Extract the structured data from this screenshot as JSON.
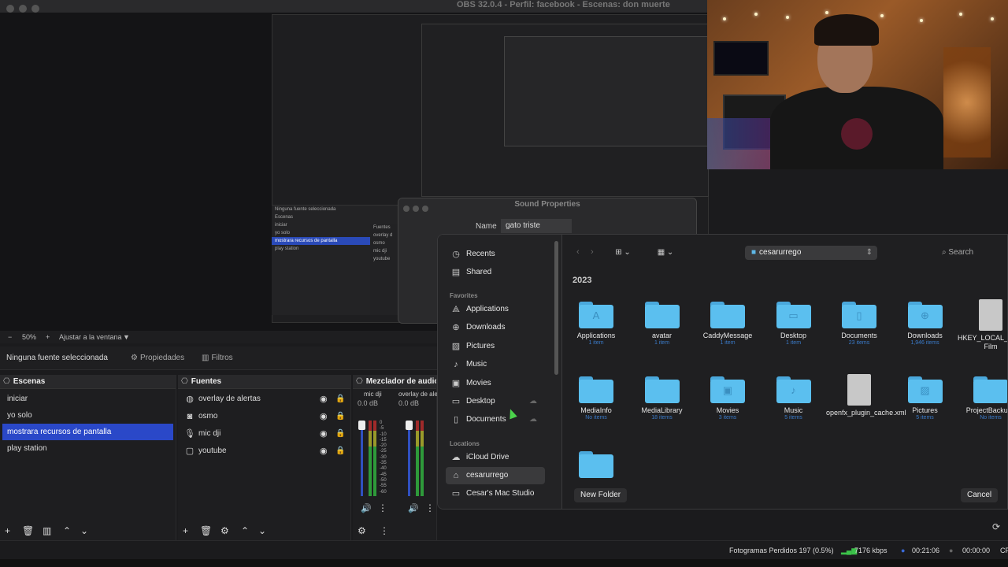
{
  "window": {
    "title": "OBS 32.0.4 - Perfil: facebook - Escenas: don muerte"
  },
  "preview": {
    "mini_scenes": [
      "Escenas",
      "iniciar",
      "yo solo",
      "mostrara recursos de pantalla",
      "play station"
    ],
    "mini_sources": [
      "Fuentes",
      "overlay d",
      "osmo",
      "mic dji",
      "youtube"
    ],
    "mini_nosel": "Ninguna fuente seleccionada",
    "mini_props": "Propiedades"
  },
  "sound_properties": {
    "title": "Sound Properties",
    "name_label": "Name",
    "name_value": "gato triste"
  },
  "zoombar": {
    "minus": "−",
    "zoom": "50%",
    "plus": "+",
    "fit": "Ajustar a la ventana",
    "caret": "▼"
  },
  "source_bar": {
    "no_selection": "Ninguna fuente seleccionada",
    "properties": "Propiedades",
    "filters": "Filtros"
  },
  "scenes": {
    "title": "Escenas",
    "items": [
      "iniciar",
      "yo solo",
      "mostrara recursos de pantalla",
      "play station"
    ],
    "selected_index": 2
  },
  "sources": {
    "title": "Fuentes",
    "items": [
      {
        "label": "overlay de alertas",
        "icon": "globe-icon"
      },
      {
        "label": "osmo",
        "icon": "camera-icon"
      },
      {
        "label": "mic dji",
        "icon": "microphone-icon"
      },
      {
        "label": "youtube",
        "icon": "window-icon"
      }
    ]
  },
  "mixer": {
    "title": "Mezclador de audio",
    "channels": [
      {
        "name": "mic dji",
        "db": "0.0 dB"
      },
      {
        "name": "overlay de ale",
        "db": "0.0 dB"
      }
    ],
    "ticks": [
      "0",
      "-5",
      "-10",
      "-15",
      "-20",
      "-25",
      "-30",
      "-35",
      "-40",
      "-45",
      "-50",
      "-55",
      "-60"
    ]
  },
  "file_dialog": {
    "sidebar": {
      "top": [
        "Recents",
        "Shared"
      ],
      "favorites_label": "Favorites",
      "favorites": [
        "Applications",
        "Downloads",
        "Pictures",
        "Music",
        "Movies",
        "Desktop",
        "Documents"
      ],
      "locations_label": "Locations",
      "locations": [
        "iCloud Drive",
        "cesarurrego",
        "Cesar's Mac Studio"
      ],
      "selected": "cesarurrego"
    },
    "location": "cesarurrego",
    "search": "Search",
    "year": "2023",
    "items": [
      {
        "name": "Applications",
        "count": "1 item",
        "type": "folder"
      },
      {
        "name": "avatar",
        "count": "1 item",
        "type": "folder"
      },
      {
        "name": "CaddyMessage",
        "count": "1 item",
        "type": "folder"
      },
      {
        "name": "Desktop",
        "count": "1 item",
        "type": "folder"
      },
      {
        "name": "Documents",
        "count": "23 items",
        "type": "folder"
      },
      {
        "name": "Downloads",
        "count": "1,946 items",
        "type": "folder"
      },
      {
        "name": "HKEY_LOCAL_MACHINE\\...e Film",
        "count": "",
        "type": "doc"
      },
      {
        "name": "MediaInfo",
        "count": "No items",
        "type": "folder"
      },
      {
        "name": "MediaLibrary",
        "count": "18 items",
        "type": "folder"
      },
      {
        "name": "Movies",
        "count": "3 items",
        "type": "folder"
      },
      {
        "name": "Music",
        "count": "5 items",
        "type": "folder"
      },
      {
        "name": "openfx_plugin_cache.xml",
        "count": "",
        "type": "doc"
      },
      {
        "name": "Pictures",
        "count": "5 items",
        "type": "folder"
      },
      {
        "name": "ProjectBackups",
        "count": "No items",
        "type": "folder"
      }
    ],
    "new_folder": "New Folder",
    "cancel": "Cancel"
  },
  "status": {
    "dropped": "Fotogramas Perdidos 197 (0.5%)",
    "bitrate": "7176 kbps",
    "stream_time": "00:21:06",
    "rec_time": "00:00:00",
    "cpu": "CP"
  },
  "colors": {
    "accent": "#2a48c8",
    "folder": "#5bbfef",
    "meter_green": "#2e9a3a",
    "meter_red": "#a02a2a"
  }
}
